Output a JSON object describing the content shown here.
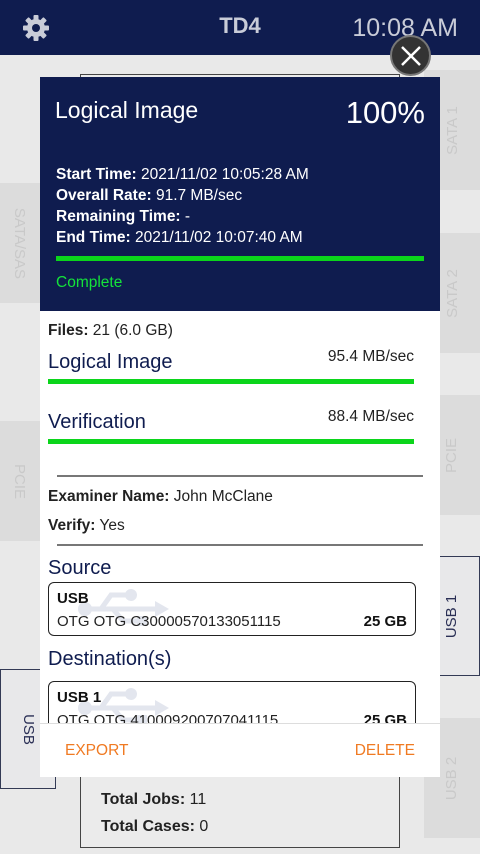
{
  "topbar": {
    "title": "TD4",
    "time": "10:08 AM",
    "settings_icon": "gear-icon"
  },
  "ports": {
    "sata1": "SATA 1",
    "sata2": "SATA 2",
    "sata_sas": "SATA/SAS",
    "pcie_right": "PCIE",
    "pcie_left": "PCIE",
    "usb1": "USB 1",
    "usb_left": "USB",
    "usb2": "USB 2"
  },
  "background_card": {
    "total_jobs_label": "Total Jobs:",
    "total_jobs_value": "11",
    "total_cases_label": "Total Cases:",
    "total_cases_value": "0"
  },
  "modal": {
    "job_name": "Logical Image",
    "percent": "100%",
    "progress_fraction": 1.0,
    "start_time_label": "Start Time:",
    "start_time_value": "2021/11/02 10:05:28 AM",
    "overall_rate_label": "Overall Rate:",
    "overall_rate_value": "91.7 MB/sec",
    "remaining_time_label": "Remaining Time:",
    "remaining_time_value": "-",
    "end_time_label": "End Time:",
    "end_time_value": "2021/11/02 10:07:40 AM",
    "status": "Complete",
    "files_label": "Files:",
    "files_value": "21 (6.0 GB)",
    "logical_image_title": "Logical Image",
    "logical_image_rate": "95.4 MB/sec",
    "logical_image_progress": 1.0,
    "verification_title": "Verification",
    "verification_rate": "88.4 MB/sec",
    "verification_progress": 1.0,
    "examiner_label": "Examiner Name:",
    "examiner_value": "John McClane",
    "verify_label": "Verify:",
    "verify_value": "Yes",
    "source_title": "Source",
    "source": {
      "name": "USB",
      "serial": "OTG OTG C30000570133051115",
      "size": "25 GB"
    },
    "destination_title": "Destination(s)",
    "destination": {
      "name": "USB 1",
      "serial": "OTG OTG 410009200707041115",
      "size": "25 GB"
    },
    "export_label": "EXPORT",
    "delete_label": "DELETE"
  },
  "colors": {
    "header_navy": "#0f1c4f",
    "progress_green": "#0bd51b",
    "status_green": "#14e33a",
    "action_orange": "#f07a22"
  }
}
